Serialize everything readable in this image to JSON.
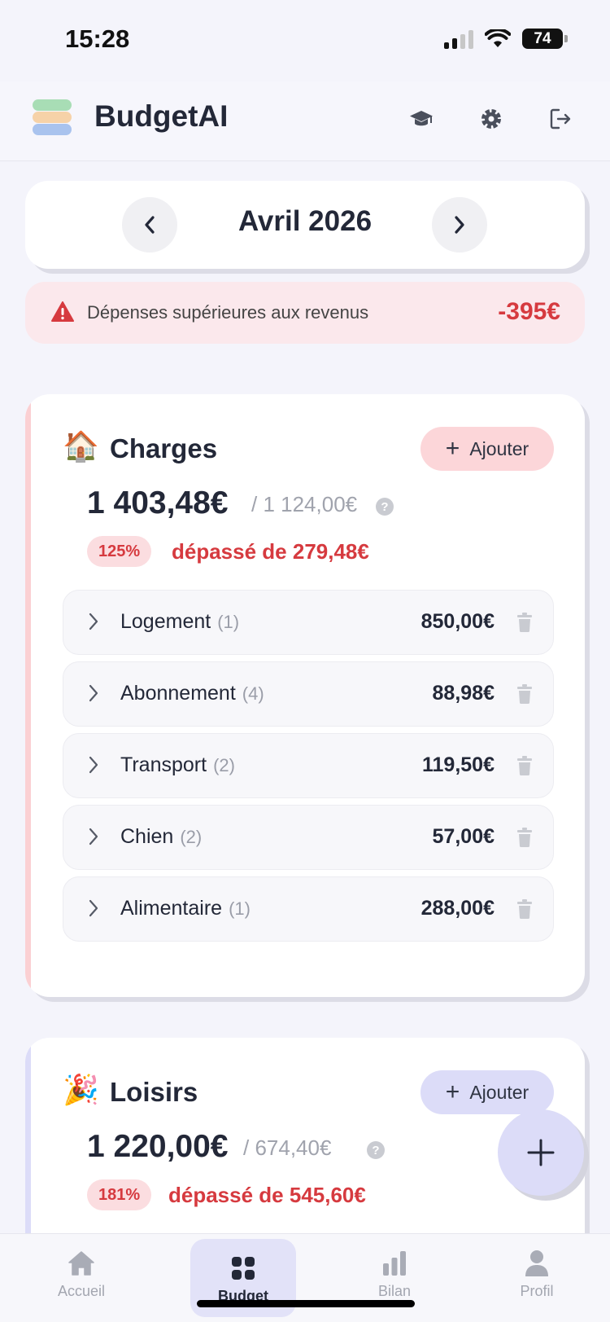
{
  "status_bar": {
    "time": "15:28",
    "battery": "74"
  },
  "header": {
    "title": "BudgetAI"
  },
  "month_selector": {
    "label": "Avril 2026"
  },
  "alert": {
    "message": "Dépenses supérieures aux revenus",
    "amount": "-395€"
  },
  "categories": [
    {
      "emoji": "🏠",
      "name": "Charges",
      "add_label": "Ajouter",
      "spent": "1 403,48€",
      "budget": "/  1 124,00€",
      "percent": "125%",
      "over_text": "dépassé de 279,48€",
      "accent_color": "#fbd0d3",
      "items": [
        {
          "label": "Logement",
          "count": "(1)",
          "amount": "850,00€"
        },
        {
          "label": "Abonnement",
          "count": "(4)",
          "amount": "88,98€"
        },
        {
          "label": "Transport",
          "count": "(2)",
          "amount": "119,50€"
        },
        {
          "label": "Chien",
          "count": "(2)",
          "amount": "57,00€"
        },
        {
          "label": "Alimentaire",
          "count": "(1)",
          "amount": "288,00€"
        }
      ]
    },
    {
      "emoji": "🎉",
      "name": "Loisirs",
      "add_label": "Ajouter",
      "spent": "1 220,00€",
      "budget": "/  674,40€",
      "percent": "181%",
      "over_text": "dépassé de 545,60€",
      "accent_color": "#dcdcf8"
    }
  ],
  "bottom_nav": [
    {
      "label": "Accueil",
      "icon": "home-icon"
    },
    {
      "label": "Budget",
      "icon": "grid-icon",
      "active": true
    },
    {
      "label": "Bilan",
      "icon": "bar-chart-icon"
    },
    {
      "label": "Profil",
      "icon": "user-icon"
    }
  ],
  "colors": {
    "danger": "#d63a3f",
    "text": "#232838",
    "background": "#f4f4fb"
  }
}
